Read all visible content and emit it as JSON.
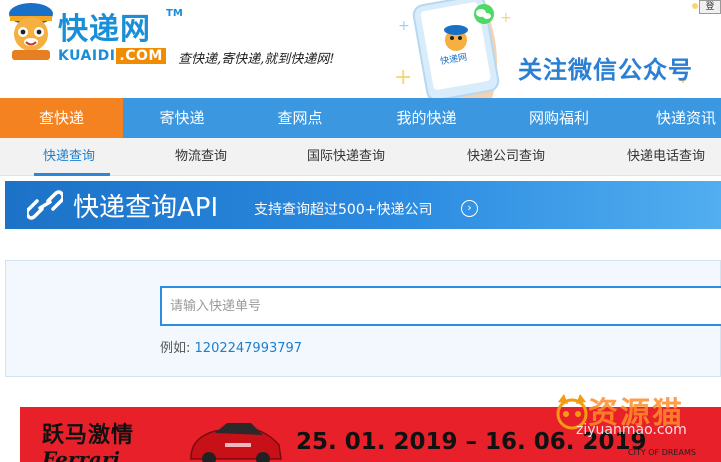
{
  "header": {
    "logo_title": "快递网",
    "logo_tm": "TM",
    "logo_domain_main": "KUAIDI",
    "logo_domain_suffix": ".COM",
    "slogan": "查快递,寄快递,就到快递网!",
    "wechat_follow": "关注微信公众号",
    "phone_screen_label": "快递网",
    "corner_button": "登"
  },
  "main_nav": {
    "items": [
      {
        "label": "查快递",
        "active": true
      },
      {
        "label": "寄快递",
        "active": false
      },
      {
        "label": "查网点",
        "active": false
      },
      {
        "label": "我的快递",
        "active": false
      },
      {
        "label": "网购福利",
        "active": false
      },
      {
        "label": "快递资讯",
        "active": false
      }
    ]
  },
  "sub_nav": {
    "items": [
      {
        "label": "快递查询",
        "active": true
      },
      {
        "label": "物流查询",
        "active": false
      },
      {
        "label": "国际快递查询",
        "active": false
      },
      {
        "label": "快递公司查询",
        "active": false
      },
      {
        "label": "快递电话查询",
        "active": false
      }
    ]
  },
  "api_banner": {
    "title": "快递查询API",
    "subtitle": "支持查询超过500+快递公司",
    "arrow": "›"
  },
  "search": {
    "placeholder": "请输入快递单号",
    "value": "",
    "example_label": "例如:",
    "example_number": "1202247993797"
  },
  "ad": {
    "title": "跃马激情",
    "brand": "Ferrari",
    "dates": "25. 01. 2019 – 16. 06. 2019",
    "city_text": "CITY OF DREAMS"
  },
  "watermark": {
    "text": "资源猫",
    "sub": "ziyuanmao.com"
  },
  "colors": {
    "brand_blue": "#1a8fd8",
    "nav_blue": "#3a97e0",
    "nav_active_orange": "#f58220",
    "sub_active_blue": "#1e7fcf",
    "ad_red": "#e8202a"
  }
}
